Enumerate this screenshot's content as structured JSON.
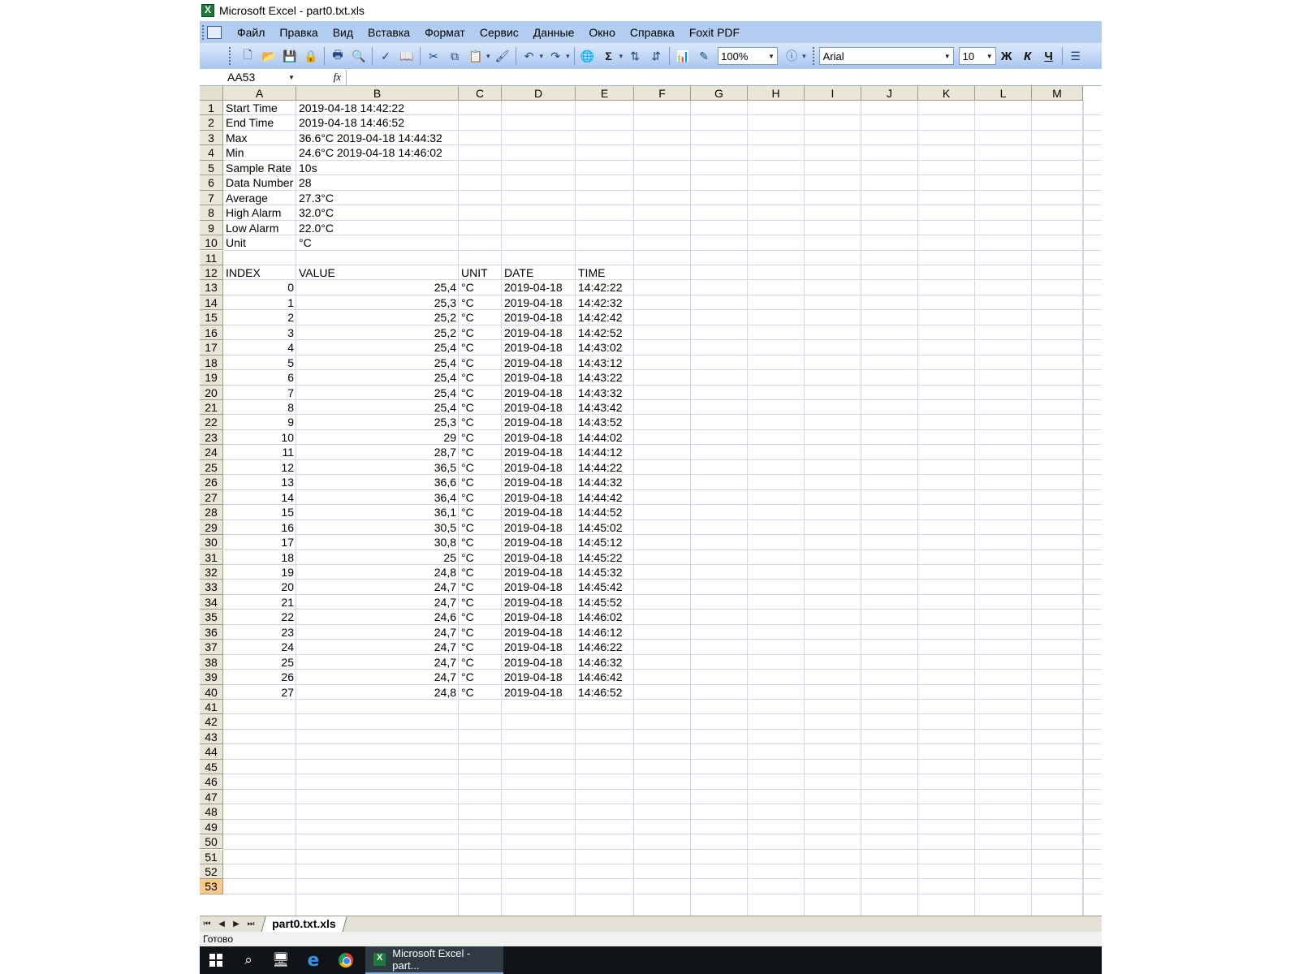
{
  "window": {
    "title": "Microsoft Excel - part0.txt.xls"
  },
  "menu": [
    "Файл",
    "Правка",
    "Вид",
    "Вставка",
    "Формат",
    "Сервис",
    "Данные",
    "Окно",
    "Справка",
    "Foxit PDF"
  ],
  "toolbar": {
    "zoom": "100%",
    "font": "Arial",
    "font_size": "10",
    "bold_label": "Ж",
    "italic_label": "К",
    "underline_label": "Ч",
    "icons": [
      "new-icon",
      "open-icon",
      "save-icon",
      "permission-icon",
      "print-icon",
      "print-preview-icon",
      "spelling-icon",
      "research-icon",
      "cut-icon",
      "copy-icon",
      "paste-icon",
      "format-painter-icon",
      "undo-icon",
      "redo-icon",
      "hyperlink-icon",
      "autosum-icon",
      "sort-ascending-icon",
      "sort-descending-icon",
      "chart-wizard-icon",
      "drawing-icon",
      "help-icon",
      "align-left-icon"
    ]
  },
  "formula_bar": {
    "name_box": "AA53",
    "fx_label": "fx",
    "content": ""
  },
  "sheet": {
    "columns": [
      "A",
      "B",
      "C",
      "D",
      "E",
      "F",
      "G",
      "H",
      "I",
      "J",
      "K",
      "L",
      "M"
    ],
    "row_numbers": [
      "1",
      "2",
      "3",
      "4",
      "5",
      "6",
      "7",
      "8",
      "9",
      "10",
      "11",
      "12",
      "13",
      "14",
      "15",
      "16",
      "17",
      "18",
      "19",
      "20",
      "21",
      "22",
      "23",
      "24",
      "25",
      "26",
      "27",
      "28",
      "29",
      "30",
      "31",
      "32",
      "33",
      "34",
      "35",
      "36",
      "37",
      "38",
      "39",
      "40",
      "41",
      "42",
      "43",
      "44",
      "45",
      "46",
      "47",
      "48",
      "49",
      "50",
      "51",
      "52",
      "53"
    ],
    "active_row": "53",
    "summary": [
      {
        "label": "Start Time",
        "value": "2019-04-18 14:42:22"
      },
      {
        "label": "End Time",
        "value": "2019-04-18 14:46:52"
      },
      {
        "label": "Max",
        "value": "36.6°C    2019-04-18 14:44:32"
      },
      {
        "label": "Min",
        "value": "24.6°C    2019-04-18 14:46:02"
      },
      {
        "label": "Sample Rate",
        "value": "10s"
      },
      {
        "label": "Data Number",
        "value": "28"
      },
      {
        "label": "Average",
        "value": "27.3°C"
      },
      {
        "label": "High Alarm",
        "value": "32.0°C"
      },
      {
        "label": "Low Alarm",
        "value": "22.0°C"
      },
      {
        "label": "Unit",
        "value": "°C"
      }
    ],
    "table_headers": [
      "INDEX",
      "VALUE",
      "UNIT",
      "DATE",
      "TIME"
    ],
    "table_rows": [
      [
        "0",
        "25,4",
        "°C",
        "2019-04-18",
        "14:42:22"
      ],
      [
        "1",
        "25,3",
        "°C",
        "2019-04-18",
        "14:42:32"
      ],
      [
        "2",
        "25,2",
        "°C",
        "2019-04-18",
        "14:42:42"
      ],
      [
        "3",
        "25,2",
        "°C",
        "2019-04-18",
        "14:42:52"
      ],
      [
        "4",
        "25,4",
        "°C",
        "2019-04-18",
        "14:43:02"
      ],
      [
        "5",
        "25,4",
        "°C",
        "2019-04-18",
        "14:43:12"
      ],
      [
        "6",
        "25,4",
        "°C",
        "2019-04-18",
        "14:43:22"
      ],
      [
        "7",
        "25,4",
        "°C",
        "2019-04-18",
        "14:43:32"
      ],
      [
        "8",
        "25,4",
        "°C",
        "2019-04-18",
        "14:43:42"
      ],
      [
        "9",
        "25,3",
        "°C",
        "2019-04-18",
        "14:43:52"
      ],
      [
        "10",
        "29",
        "°C",
        "2019-04-18",
        "14:44:02"
      ],
      [
        "11",
        "28,7",
        "°C",
        "2019-04-18",
        "14:44:12"
      ],
      [
        "12",
        "36,5",
        "°C",
        "2019-04-18",
        "14:44:22"
      ],
      [
        "13",
        "36,6",
        "°C",
        "2019-04-18",
        "14:44:32"
      ],
      [
        "14",
        "36,4",
        "°C",
        "2019-04-18",
        "14:44:42"
      ],
      [
        "15",
        "36,1",
        "°C",
        "2019-04-18",
        "14:44:52"
      ],
      [
        "16",
        "30,5",
        "°C",
        "2019-04-18",
        "14:45:02"
      ],
      [
        "17",
        "30,8",
        "°C",
        "2019-04-18",
        "14:45:12"
      ],
      [
        "18",
        "25",
        "°C",
        "2019-04-18",
        "14:45:22"
      ],
      [
        "19",
        "24,8",
        "°C",
        "2019-04-18",
        "14:45:32"
      ],
      [
        "20",
        "24,7",
        "°C",
        "2019-04-18",
        "14:45:42"
      ],
      [
        "21",
        "24,7",
        "°C",
        "2019-04-18",
        "14:45:52"
      ],
      [
        "22",
        "24,6",
        "°C",
        "2019-04-18",
        "14:46:02"
      ],
      [
        "23",
        "24,7",
        "°C",
        "2019-04-18",
        "14:46:12"
      ],
      [
        "24",
        "24,7",
        "°C",
        "2019-04-18",
        "14:46:22"
      ],
      [
        "25",
        "24,7",
        "°C",
        "2019-04-18",
        "14:46:32"
      ],
      [
        "26",
        "24,7",
        "°C",
        "2019-04-18",
        "14:46:42"
      ],
      [
        "27",
        "24,8",
        "°C",
        "2019-04-18",
        "14:46:52"
      ]
    ]
  },
  "sheet_tabs": [
    "part0.txt.xls"
  ],
  "status": {
    "text": "Готово"
  },
  "taskbar": {
    "icons": [
      "windows-start-icon",
      "search-icon",
      "desktop-icon",
      "edge-icon",
      "chrome-icon"
    ],
    "active_app": "Microsoft Excel - part..."
  },
  "colors": {
    "menubar": "#b3cdf0",
    "header": "#e9e6d8",
    "active_row_header": "#f8c987",
    "taskbar": "#101418"
  }
}
